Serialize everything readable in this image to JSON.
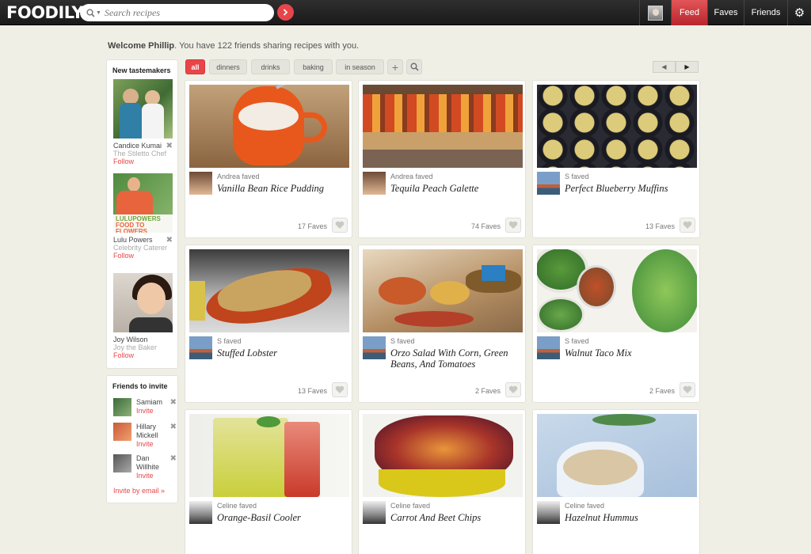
{
  "header": {
    "logo": "FOODILY",
    "search_placeholder": "Search recipes",
    "nav": {
      "feed": "Feed",
      "faves": "Faves",
      "friends": "Friends"
    }
  },
  "welcome": {
    "name": "Welcome Phillip",
    "message": ". You have 122 friends sharing recipes with you."
  },
  "tastemakers": {
    "title": "New tastemakers",
    "items": [
      {
        "name": "Candice Kumai",
        "role": "The Stiletto Chef",
        "follow": "Follow"
      },
      {
        "name": "Lulu Powers",
        "role": "Celebrity Caterer",
        "follow": "Follow"
      },
      {
        "name": "Joy Wilson",
        "role": "Joy the Baker",
        "follow": "Follow"
      }
    ]
  },
  "invite": {
    "title": "Friends to invite",
    "friends": [
      {
        "name": "Samiam",
        "action": "Invite"
      },
      {
        "name": "Hillary Mickell",
        "action": "Invite"
      },
      {
        "name": "Dan Willhite",
        "action": "Invite"
      }
    ],
    "email": "Invite by email »"
  },
  "filters": [
    "all",
    "dinners",
    "drinks",
    "baking",
    "in season"
  ],
  "pager": {
    "prev": "◀",
    "next": "▶"
  },
  "cards": [
    {
      "faved": "Andrea faved",
      "title": "Vanilla Bean Rice Pudding",
      "faves": "17 Faves"
    },
    {
      "faved": "Andrea faved",
      "title": "Tequila Peach Galette",
      "faves": "74 Faves"
    },
    {
      "faved": "S faved",
      "title": "Perfect Blueberry Muffins",
      "faves": "13 Faves"
    },
    {
      "faved": "S faved",
      "title": "Stuffed Lobster",
      "faves": "13 Faves"
    },
    {
      "faved": "S faved",
      "title": "Orzo Salad With Corn, Green Beans, And Tomatoes",
      "faves": "2 Faves"
    },
    {
      "faved": "S faved",
      "title": "Walnut Taco Mix",
      "faves": "2 Faves"
    },
    {
      "faved": "Celine faved",
      "title": "Orange-Basil Cooler",
      "faves": ""
    },
    {
      "faved": "Celine faved",
      "title": "Carrot And Beet Chips",
      "faves": ""
    },
    {
      "faved": "Celine faved",
      "title": "Hazelnut Hummus",
      "faves": ""
    }
  ],
  "colors": {
    "accent": "#e8454a",
    "topbar": "#222222",
    "background": "#efefe6"
  }
}
